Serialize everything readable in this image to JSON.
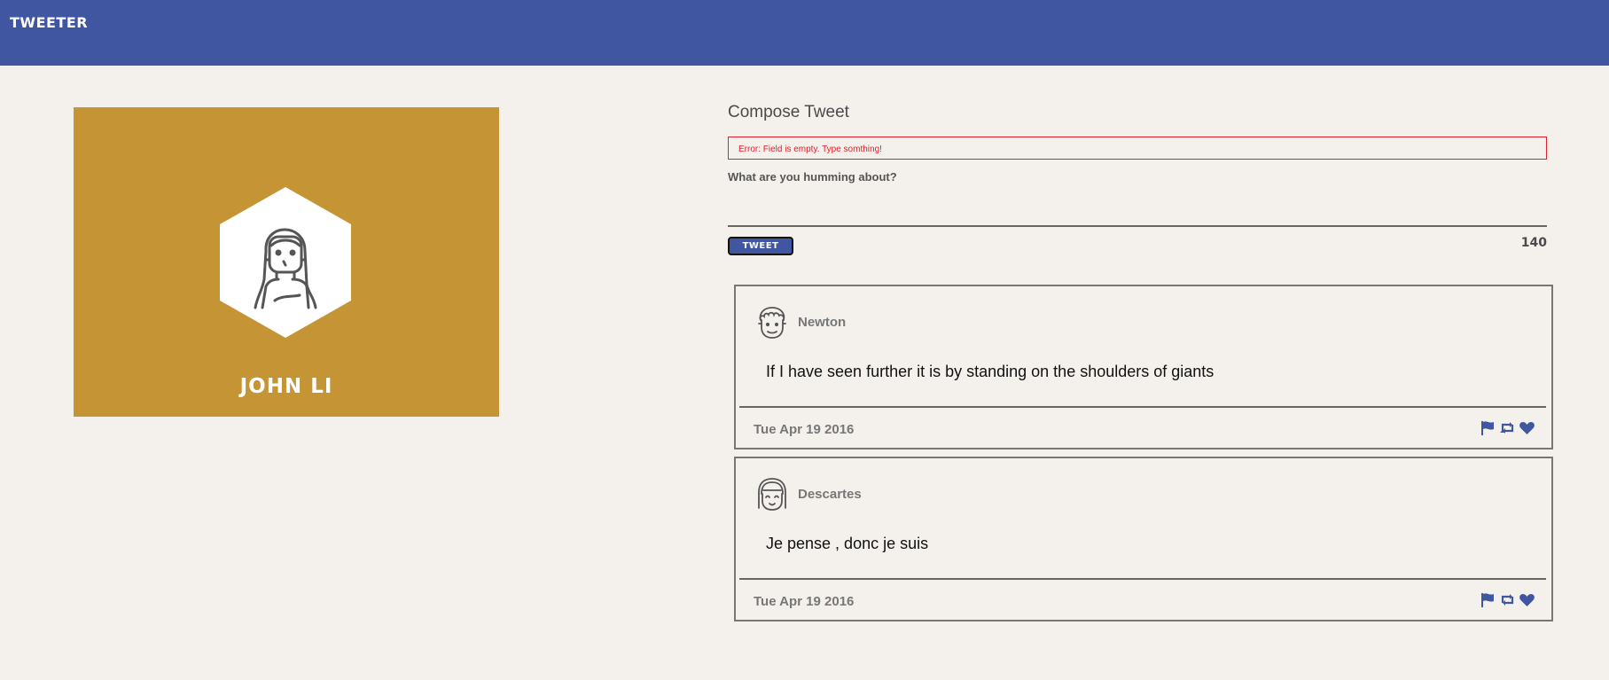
{
  "app": {
    "title": "TWEETER"
  },
  "profile": {
    "name": "JOHN LI",
    "background_color": "#c59535"
  },
  "compose": {
    "title": "Compose Tweet",
    "error": "Error: Field is empty. Type somthing!",
    "prompt": "What are you humming about?",
    "input_value": "",
    "button_label": "TWEET",
    "char_count": "140"
  },
  "colors": {
    "brand": "#4056a1",
    "error": "#e0202a",
    "background": "#f4f1ec"
  },
  "tweets": [
    {
      "handle": "Newton",
      "avatar": "man-curly-hair-icon",
      "text": "If I have seen further it is by standing on the shoulders of giants",
      "date": "Tue Apr 19 2016"
    },
    {
      "handle": "Descartes",
      "avatar": "woman-bangs-icon",
      "text": "Je pense , donc je suis",
      "date": "Tue Apr 19 2016"
    }
  ],
  "tweet_actions": [
    "flag-icon",
    "retweet-icon",
    "heart-icon"
  ]
}
